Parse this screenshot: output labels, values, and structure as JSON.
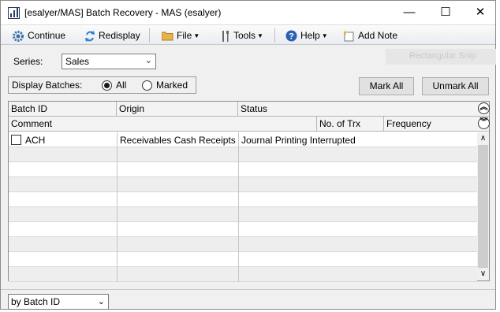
{
  "window": {
    "title": "[esalyer/MAS] Batch Recovery  -  MAS (esalyer)",
    "min_glyph": "—",
    "max_glyph": "☐",
    "close_glyph": "✕"
  },
  "background": {
    "snip_label": "Rectangular Snip"
  },
  "toolbar": {
    "continue": "Continue",
    "redisplay": "Redisplay",
    "file": "File",
    "tools": "Tools",
    "help": "Help",
    "add_note": "Add Note"
  },
  "series": {
    "label": "Series:",
    "value": "Sales"
  },
  "display_batches": {
    "label": "Display Batches:",
    "options": [
      "All",
      "Marked"
    ],
    "selected": "All"
  },
  "buttons": {
    "mark_all": "Mark All",
    "unmark_all": "Unmark All"
  },
  "grid": {
    "headers_row1": [
      "Batch ID",
      "Origin",
      "Status"
    ],
    "headers_row2": [
      "Comment",
      "No. of Trx",
      "Frequency"
    ],
    "rows": [
      {
        "checked": false,
        "batch_id": "ACH",
        "origin": "Receivables Cash Receipts",
        "status": "Journal Printing Interrupted"
      }
    ],
    "empty_rows": 9
  },
  "sort": {
    "value": "by Batch ID"
  },
  "icons": {
    "app": "bar-chart-icon",
    "continue": "gear-icon",
    "redisplay": "refresh-icon",
    "file": "folder-icon",
    "tools": "wrench-icon",
    "help": "help-icon",
    "add_note": "note-icon"
  }
}
